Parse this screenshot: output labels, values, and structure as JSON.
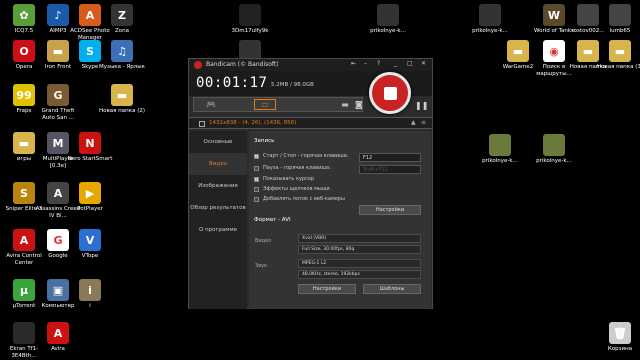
{
  "desktop": {
    "icons": [
      {
        "label": "ICQ7.5",
        "color": "#5a9e3a",
        "glyph": "✿"
      },
      {
        "label": "AIMP3",
        "color": "#1a5aa8",
        "glyph": "♪"
      },
      {
        "label": "ACDSee Photo Manager",
        "color": "#d65b1c",
        "glyph": "A"
      },
      {
        "label": "Zona",
        "color": "#333",
        "glyph": "Z"
      },
      {
        "label": "Opera",
        "color": "#cc0f16",
        "glyph": "O"
      },
      {
        "label": "Iron Front",
        "color": "#c8a24a",
        "glyph": "▬"
      },
      {
        "label": "Skype",
        "color": "#00aff0",
        "glyph": "S"
      },
      {
        "label": "Музыка - Ярлык",
        "color": "#3b6fb6",
        "glyph": "♫"
      },
      {
        "label": "Fraps",
        "color": "#e0c100",
        "glyph": "99"
      },
      {
        "label": "Grand Theft Auto San ...",
        "color": "#7a5a32",
        "glyph": "G"
      },
      {
        "label": "Новая папка (2)",
        "color": "#d8b54a",
        "glyph": "▬"
      },
      {
        "label": "игры",
        "color": "#d8b54a",
        "glyph": "▬"
      },
      {
        "label": "MultiPlayer [0.3e]",
        "color": "#556",
        "glyph": "M"
      },
      {
        "label": "Nero StartSmart",
        "color": "#cc1111",
        "glyph": "N"
      },
      {
        "label": "Sniper Elite 3",
        "color": "#b8860b",
        "glyph": "S"
      },
      {
        "label": "Assassins Creed IV Bl...",
        "color": "#444",
        "glyph": "A"
      },
      {
        "label": "PotPlayer",
        "color": "#e6a700",
        "glyph": "▶"
      },
      {
        "label": "Avira Control Center",
        "color": "#cc1111",
        "glyph": "A"
      },
      {
        "label": "Google",
        "color": "#fff",
        "glyph": "G"
      },
      {
        "label": "VTope",
        "color": "#2b6fd1",
        "glyph": "V"
      },
      {
        "label": "µTorrent",
        "color": "#3ba53b",
        "glyph": "µ"
      },
      {
        "label": "Компьютер",
        "color": "#4a6fa0",
        "glyph": "▣"
      },
      {
        "label": "i",
        "color": "#8a7a5a",
        "glyph": "i"
      },
      {
        "label": "Avira",
        "color": "#cc1111",
        "glyph": "A"
      },
      {
        "label": "Ekran Tf1-3E4Bth...",
        "color": "#2a2a2a",
        "glyph": ""
      },
      {
        "label": "3Dm17ulfy9k",
        "color": "#222",
        "glyph": ""
      },
      {
        "label": "prikolnye-k...",
        "color": "#333",
        "glyph": ""
      },
      {
        "label": "prikolnye-k...",
        "color": "#333",
        "glyph": ""
      },
      {
        "label": "World of Tanks",
        "color": "#5a4a2a",
        "glyph": "W"
      },
      {
        "label": "rostov002...",
        "color": "#444",
        "glyph": ""
      },
      {
        "label": "lumb65",
        "color": "#444",
        "glyph": ""
      },
      {
        "label": "WarGame2",
        "color": "#d8b54a",
        "glyph": "▬"
      },
      {
        "label": "Поиск в маршруты...",
        "color": "#fff",
        "glyph": "◉"
      },
      {
        "label": "Новая папка",
        "color": "#d8b54a",
        "glyph": "▬"
      },
      {
        "label": "Новая папка (3)",
        "color": "#d8b54a",
        "glyph": "▬"
      },
      {
        "label": "prikolnye-k...",
        "color": "#6a7a3a",
        "glyph": ""
      },
      {
        "label": "prikolnye-k...",
        "color": "#6a7a3a",
        "glyph": ""
      },
      {
        "label": "Корзина",
        "color": "#ccc",
        "glyph": "🗑"
      },
      {
        "label": "mp3cloud",
        "color": "#333",
        "glyph": ""
      }
    ]
  },
  "window": {
    "title": "Bandicam (© Bandisoft)",
    "timer": "00:01:17",
    "size": "5.2MB / 98.0GB",
    "area_text": "1432x838 - (4, 26), (1436, 856)",
    "sidebar": [
      "Основные",
      "Видео",
      "Изображения",
      "Обзор результатов",
      "О программе"
    ],
    "panel": {
      "record_title": "Запись",
      "rows": [
        {
          "label": "Старт / Стоп - горячая клавиша:",
          "checked": true
        },
        {
          "label": "Пауза - горячая клавиша:",
          "checked": false
        },
        {
          "label": "Показывать курсор",
          "checked": true
        },
        {
          "label": "Эффекты щелчков мыши",
          "checked": false
        },
        {
          "label": "Добавлять поток с веб-камеры",
          "checked": false
        }
      ],
      "hotkey_start": "F12",
      "hotkey_pause": "Shift+F12",
      "settings_btn": "Настройки",
      "format_title": "Формат - AVI",
      "video_label": "Видео",
      "video_codec": "Xvid (VBR)",
      "video_info": "Full Size, 30.00fps, 80q",
      "audio_label": "Звук",
      "audio_codec": "MPEG-1 L2",
      "audio_info": "48.0KHz, stereo, 192kbps",
      "btn_settings": "Настройки",
      "btn_templates": "Шаблоны"
    }
  }
}
